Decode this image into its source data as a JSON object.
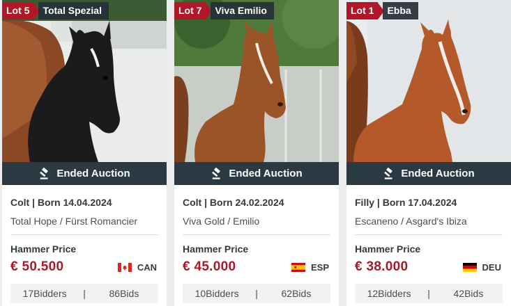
{
  "cards": [
    {
      "lot": "Lot 5",
      "name": "Total Spezial",
      "status": "Ended Auction",
      "sex_born": "Colt | Born 14.04.2024",
      "pedigree": "Total Hope / Fürst Romancier",
      "hammer_label": "Hammer Price",
      "price": "€ 50.500",
      "country": "CAN",
      "bidders_count": "17",
      "bidders_label": "Bidders",
      "bids_count": "86",
      "bids_label": "Bids",
      "flag_icon": "canada-flag-icon",
      "coat_color": "#1c1a1c"
    },
    {
      "lot": "Lot 7",
      "name": "Viva Emilio",
      "status": "Ended Auction",
      "sex_born": "Colt | Born 24.02.2024",
      "pedigree": "Viva Gold / Emilio",
      "hammer_label": "Hammer Price",
      "price": "€ 45.000",
      "country": "ESP",
      "bidders_count": "10",
      "bidders_label": "Bidders",
      "bids_count": "62",
      "bids_label": "Bids",
      "flag_icon": "spain-flag-icon",
      "coat_color": "#9a5428"
    },
    {
      "lot": "Lot 1",
      "name": "Ebba",
      "status": "Ended Auction",
      "sex_born": "Filly | Born 17.04.2024",
      "pedigree": "Escaneno / Asgard's Ibiza",
      "hammer_label": "Hammer Price",
      "price": "€ 38.000",
      "country": "DEU",
      "bidders_count": "12",
      "bidders_label": "Bidders",
      "bids_count": "42",
      "bids_label": "Bids",
      "flag_icon": "germany-flag-icon",
      "coat_color": "#b4592a"
    }
  ],
  "colors": {
    "lot_badge": "#b0182a",
    "status_bar": "#2b3942",
    "price": "#a8182a"
  },
  "icons": {
    "status": "gavel-icon"
  }
}
